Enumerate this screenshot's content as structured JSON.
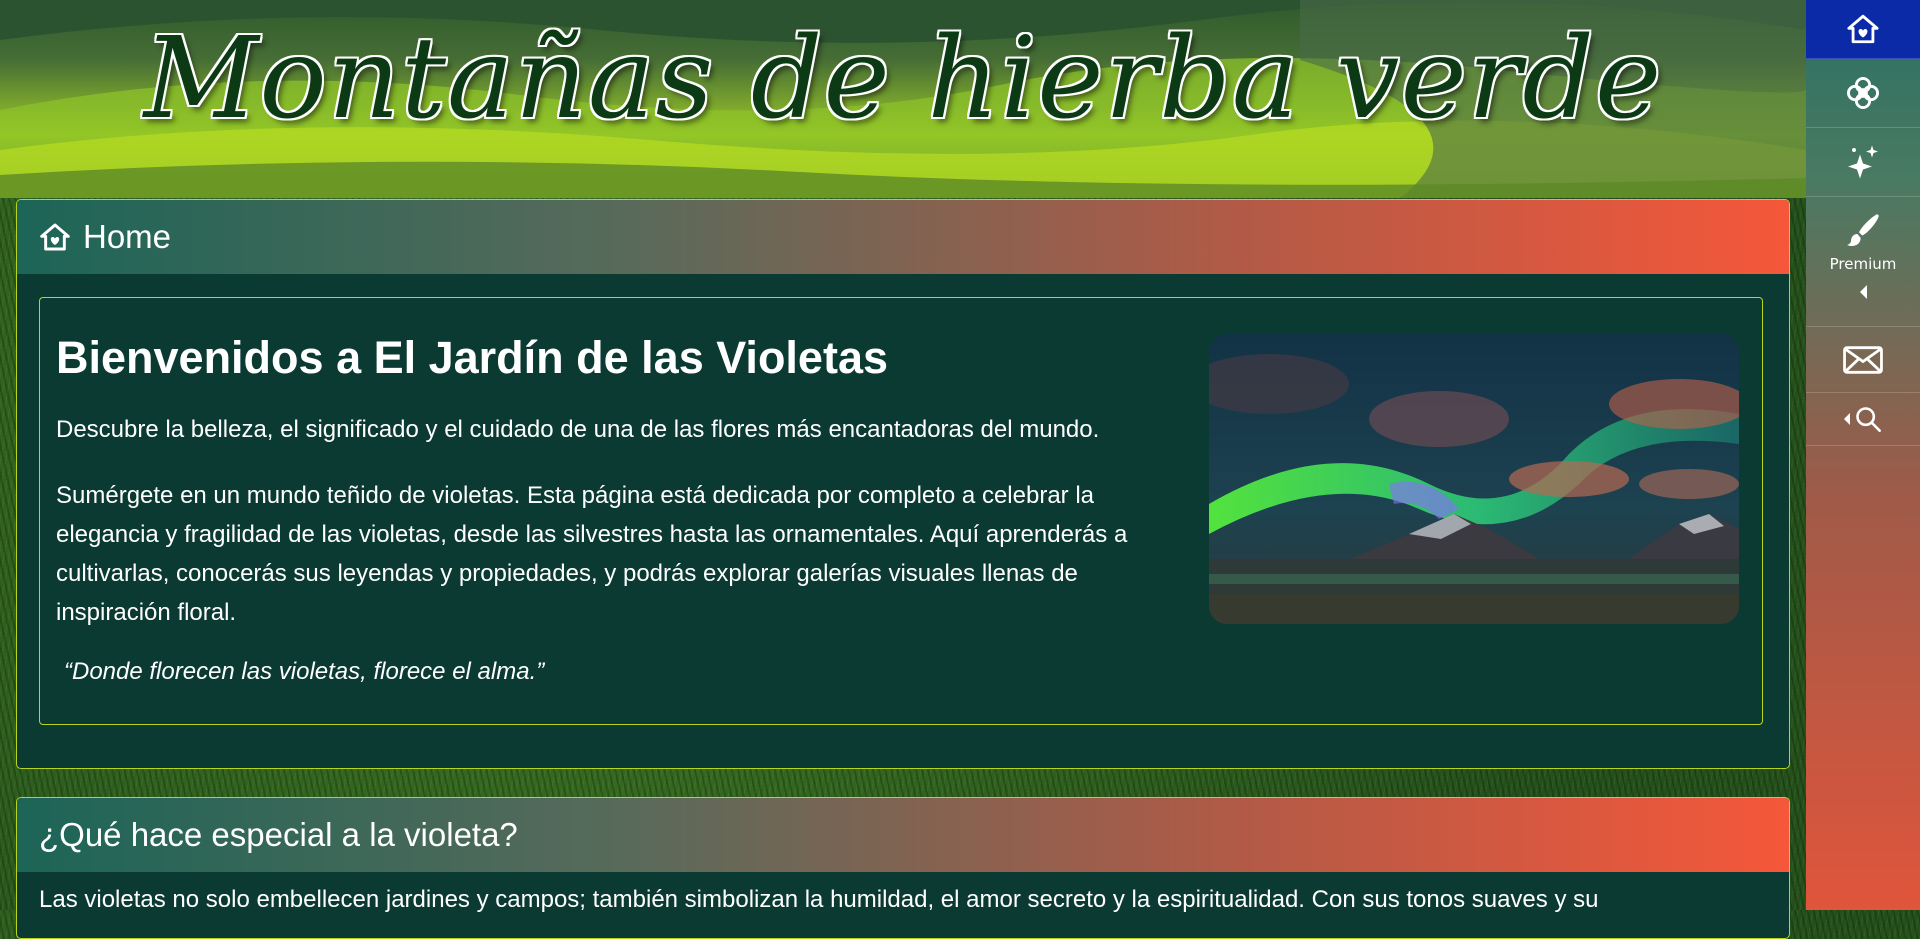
{
  "banner": {
    "title": "Montañas de hierba verde"
  },
  "sidenav": {
    "items": [
      {
        "icon": "home-icon",
        "active": true
      },
      {
        "icon": "flower-icon"
      },
      {
        "icon": "sparkles-icon"
      },
      {
        "icon": "brush-icon",
        "label": "Premium"
      },
      {
        "icon": "mail-icon"
      },
      {
        "icon": "search-icon"
      }
    ],
    "active_color": "#0b2aa8"
  },
  "home_panel": {
    "header": "Home",
    "title": "Bienvenidos a El Jardín de las Violetas",
    "lead": "Descubre la belleza, el significado y el cuidado de una de las flores más encantadoras del mundo.",
    "body": "Sumérgete en un mundo teñido de violetas. Esta página está dedicada por completo a celebrar la elegancia y fragilidad de las violetas, desde las silvestres hasta las ornamentales. Aquí aprenderás a cultivarlas, conocerás sus leyendas y propiedades, y podrás explorar galerías visuales llenas de inspiración floral.",
    "quote": "“Donde florecen las violetas, florece el alma.”"
  },
  "special_panel": {
    "header": "¿Qué hace especial a la violeta?",
    "text": "Las violetas no solo embellecen jardines y campos; también simbolizan la humildad, el amor secreto y la espiritualidad. Con sus tonos suaves y su"
  },
  "colors": {
    "panel_bg": "#0b3a33",
    "border_accent": "#b6d61e",
    "header_gradient_start": "#1c6557",
    "header_gradient_end": "#f5573a"
  }
}
